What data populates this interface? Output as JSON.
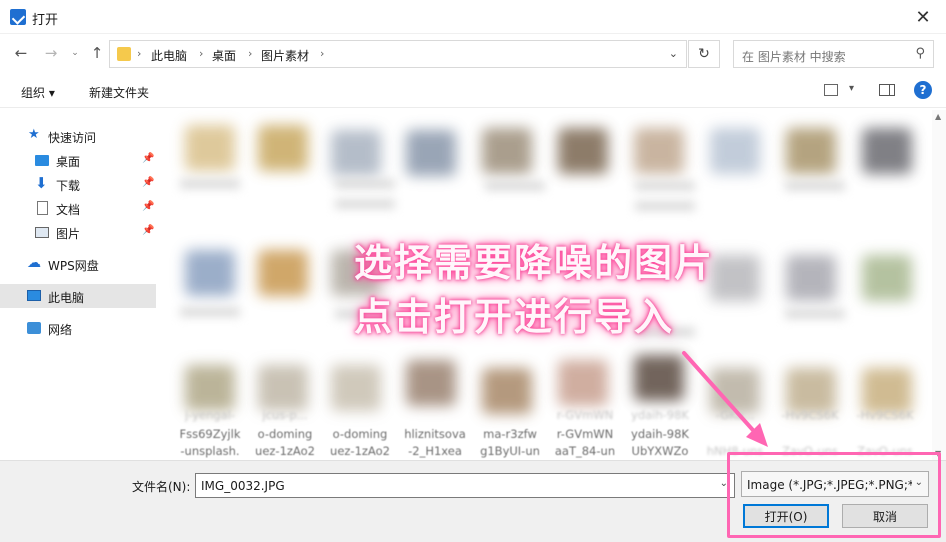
{
  "window": {
    "title": "打开",
    "close_glyph": "✕"
  },
  "nav": {
    "back_glyph": "←",
    "forward_glyph": "→",
    "dropdown_glyph": "⌄",
    "up_glyph": "↑",
    "breadcrumbs": [
      "此电脑",
      "桌面",
      "图片素材"
    ],
    "breadcrumb_sep": "›",
    "refresh_glyph": "↻",
    "search_placeholder": "在 图片素材 中搜索",
    "search_glyph": "⚲"
  },
  "toolbar": {
    "organize": "组织 ▾",
    "new_folder": "新建文件夹",
    "help": "?"
  },
  "sidebar": {
    "items": [
      {
        "label": "快速访问",
        "icon": "star-icon",
        "pinned": false
      },
      {
        "label": "桌面",
        "icon": "desktop-icon",
        "pinned": true
      },
      {
        "label": "下载",
        "icon": "download-icon",
        "pinned": true
      },
      {
        "label": "文档",
        "icon": "document-icon",
        "pinned": true
      },
      {
        "label": "图片",
        "icon": "pictures-icon",
        "pinned": true
      },
      {
        "label": "WPS网盘",
        "icon": "cloud-icon",
        "pinned": false
      },
      {
        "label": "此电脑",
        "icon": "computer-icon",
        "pinned": false,
        "selected": true
      },
      {
        "label": "网络",
        "icon": "network-icon",
        "pinned": false
      }
    ],
    "pin_glyph": "✎"
  },
  "files": {
    "row_faint": [
      "j-yengal-",
      "jcus-p...",
      "",
      "",
      "",
      "r-GVmWN",
      "ydaih-98K",
      "-GKu...",
      "-Hv9CS6K",
      "-Hv9CS6K"
    ],
    "row_line1": [
      "Fss69Zyjlk",
      "o-doming",
      "o-doming",
      "hliznitsova",
      "ma-r3zfw",
      "r-GVmWN",
      "ydaih-98K",
      "hNH8-uns",
      "ZavO-uns",
      "ZavO-uns"
    ],
    "row_line2": [
      "-unsplash.",
      "uez-1zAo2",
      "uez-1zAo2",
      "-2_H1xea",
      "g1ByUI-un",
      "aaT_84-un",
      "UbYXWZo",
      "",
      "",
      ""
    ]
  },
  "overlay": {
    "line1": "选择需要降噪的图片",
    "line2": "点击打开进行导入"
  },
  "bottom": {
    "filename_label": "文件名(N):",
    "filename_value": "IMG_0032.JPG",
    "filter_value": "Image (*.JPG;*.JPEG;*.PNG;*.BMP;*.TIF)",
    "open_button": "打开(O)",
    "cancel_button": "取消"
  },
  "colors": {
    "accent": "#0078d7",
    "highlight": "#ff66b3",
    "overlay_glow": "#ff4fa0"
  }
}
